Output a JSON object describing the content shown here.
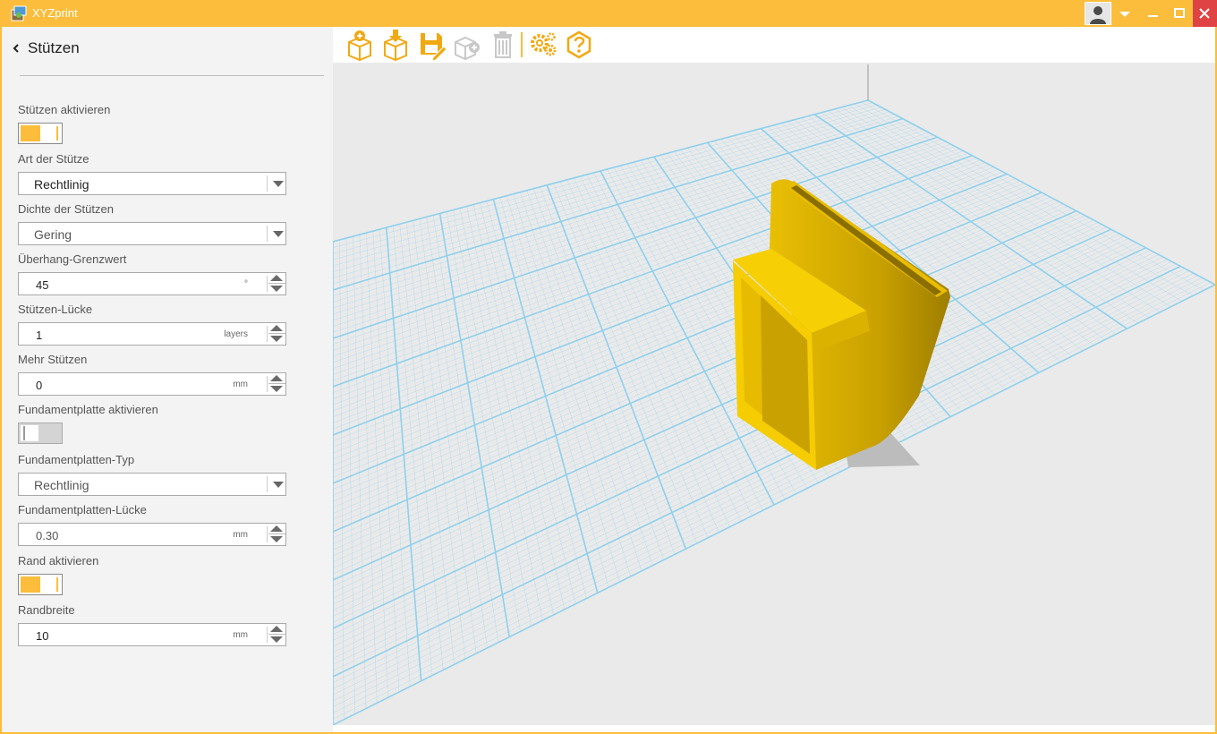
{
  "window": {
    "title": "XYZprint",
    "accent_color": "#fbbd3b"
  },
  "panel": {
    "title": "Stützen",
    "back_icon": "chevron-left-icon"
  },
  "settings": {
    "supports_enable": {
      "label": "Stützen aktivieren",
      "on": true
    },
    "support_type": {
      "label": "Art der Stütze",
      "value": "Rechtlinig"
    },
    "support_density": {
      "label": "Dichte der Stützen",
      "value": "Gering"
    },
    "overhang_threshold": {
      "label": "Überhang-Grenzwert",
      "value": "45",
      "unit": "°"
    },
    "support_gap": {
      "label": "Stützen-Lücke",
      "value": "1",
      "unit": "layers"
    },
    "more_supports": {
      "label": "Mehr Stützen",
      "value": "0",
      "unit": "mm"
    },
    "raft_enable": {
      "label": "Fundamentplatte aktivieren",
      "on": false
    },
    "raft_type": {
      "label": "Fundamentplatten-Typ",
      "value": "Rechtlinig"
    },
    "raft_gap": {
      "label": "Fundamentplatten-Lücke",
      "value": "0.30",
      "unit": "mm"
    },
    "brim_enable": {
      "label": "Rand aktivieren",
      "on": true
    },
    "brim_width": {
      "label": "Randbreite",
      "value": "10",
      "unit": "mm"
    }
  },
  "toolbar": {
    "icons": [
      "import-model-icon",
      "load-model-icon",
      "save-edit-icon",
      "add-copy-icon",
      "trash-icon",
      "settings-gears-icon",
      "help-icon"
    ]
  },
  "viewport": {
    "grid_color": "#8ed0ee",
    "model_color": "#f7cf05"
  }
}
